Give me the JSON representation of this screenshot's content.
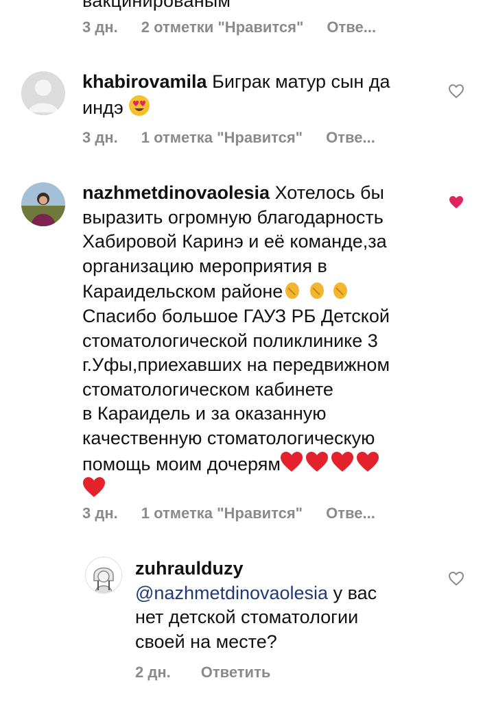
{
  "top_comment": {
    "truncated_text": "вакцинированым",
    "time": "3 дн.",
    "likes": "2 отметки \"Нравится\"",
    "reply": "Отве..."
  },
  "comments": [
    {
      "username": "khabirovamila",
      "text_line1": "Биграк матур сын да",
      "text_line2": "индэ",
      "emoji": "heart-eyes",
      "time": "3 дн.",
      "likes": "1 отметка \"Нравится\"",
      "reply": "Отве...",
      "liked": false
    },
    {
      "username": "nazhmetdinovaolesia",
      "lines": [
        "Хотелось бы",
        "выразить огромную благодарность",
        "Хабировой Каринэ и её команде,за",
        "организацию мероприятия в",
        "Караидельском районе",
        "Спасибо большое ГАУЗ РБ Детской",
        "стоматологической поликлинике 3",
        "г.Уфы,приехавших на передвижном",
        "стоматологическом кабинете",
        "в Караидель и за оказанную",
        "качественную стоматологическую",
        "помощь моим дочерям"
      ],
      "emoji_clap": "clapping-hands",
      "emoji_heart": "red-heart",
      "time": "3 дн.",
      "likes": "1 отметка \"Нравится\"",
      "reply": "Отве...",
      "liked": true
    }
  ],
  "reply_comment": {
    "username": "zuhraulduzy",
    "mention": "@nazhmetdinovaolesia",
    "line1_rest": " у вас",
    "line2": "нет детской стоматологии",
    "line3": "своей на месте?",
    "time": "2 дн.",
    "reply": "Ответить",
    "liked": false
  },
  "colors": {
    "meta": "#8a8a8a",
    "like_red": "#e0245e",
    "mention": "#1e3a78"
  }
}
